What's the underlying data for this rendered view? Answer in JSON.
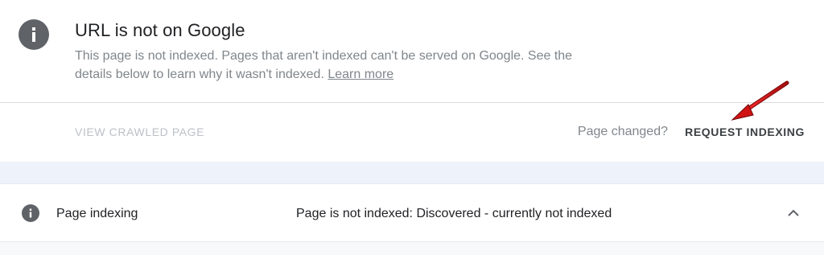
{
  "status": {
    "title": "URL is not on Google",
    "description": "This page is not indexed. Pages that aren't indexed can't be served on Google. See the details below to learn why it wasn't indexed.",
    "learn_more": "Learn more",
    "icon": "info-icon"
  },
  "actions": {
    "view_crawled": "VIEW CRAWLED PAGE",
    "page_changed": "Page changed?",
    "request_indexing": "REQUEST INDEXING"
  },
  "indexing_row": {
    "icon": "info-icon",
    "label": "Page indexing",
    "value": "Page is not indexed: Discovered - currently not indexed",
    "expand_icon": "chevron-up-icon"
  },
  "colors": {
    "icon_gray": "#5f6368",
    "annotation_arrow": "#cc1111",
    "disabled_text": "#bdc1c6",
    "secondary_text": "#80868b"
  }
}
